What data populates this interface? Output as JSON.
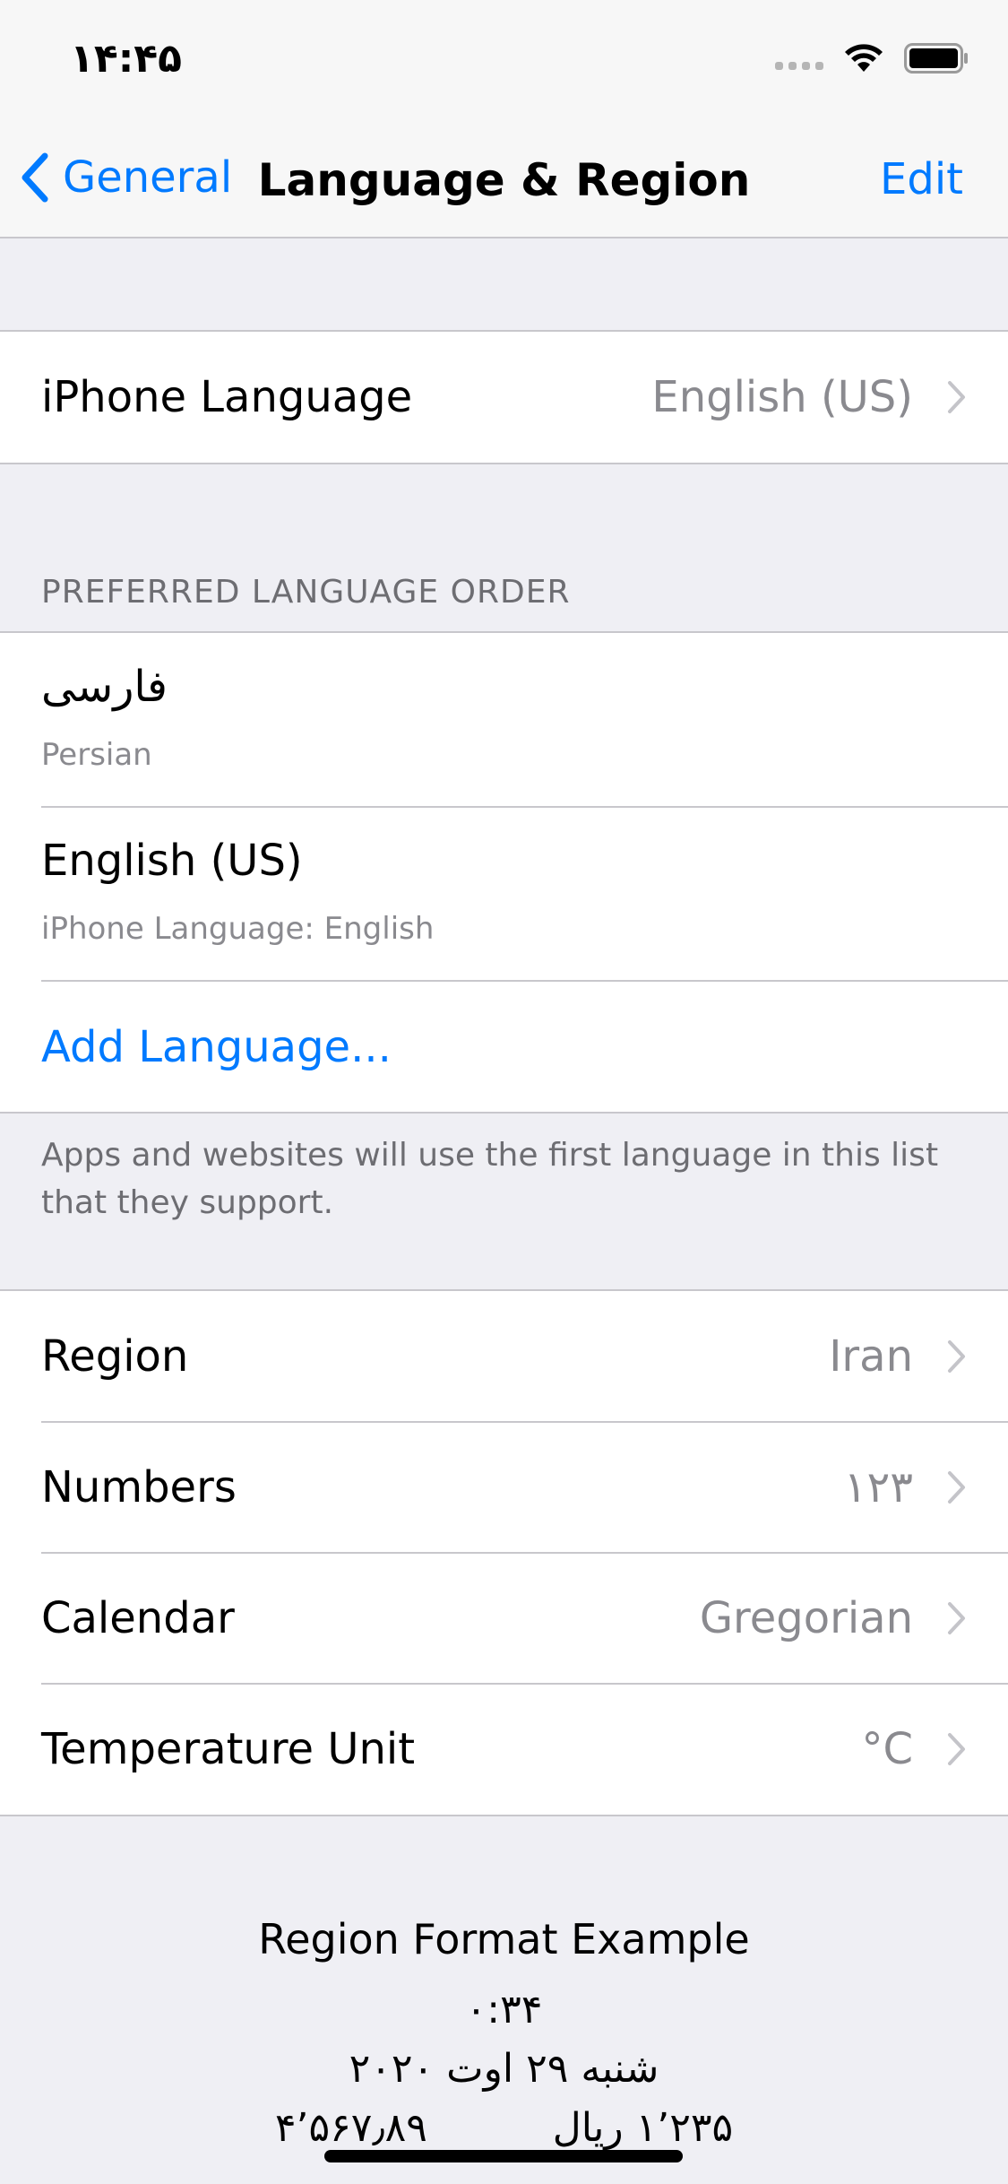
{
  "status_bar": {
    "time": "۱۴:۴۵"
  },
  "nav": {
    "back_label": "General",
    "title": "Language & Region",
    "edit_label": "Edit"
  },
  "iphone_language": {
    "label": "iPhone Language",
    "value": "English (US)"
  },
  "preferred": {
    "header": "PREFERRED LANGUAGE ORDER",
    "languages": [
      {
        "primary": "فارسی",
        "secondary": "Persian"
      },
      {
        "primary": "English (US)",
        "secondary": "iPhone Language: English"
      }
    ],
    "add_label": "Add Language...",
    "footer": "Apps and websites will use the first language in this list that they support."
  },
  "region_settings": [
    {
      "label": "Region",
      "value": "Iran"
    },
    {
      "label": "Numbers",
      "value": "۱۲۳"
    },
    {
      "label": "Calendar",
      "value": "Gregorian"
    },
    {
      "label": "Temperature Unit",
      "value": "°C"
    }
  ],
  "region_example": {
    "title": "Region Format Example",
    "time": "۰:۳۴",
    "date": "شنبه ۲۹ اوت ۲۰۲۰",
    "numbers": "۱٬۲۳۵ ریال          ۴٬۵۶۷٫۸۹"
  },
  "colors": {
    "accent": "#007aff",
    "secondary_text": "#8a8a8f",
    "background": "#efeff4"
  }
}
